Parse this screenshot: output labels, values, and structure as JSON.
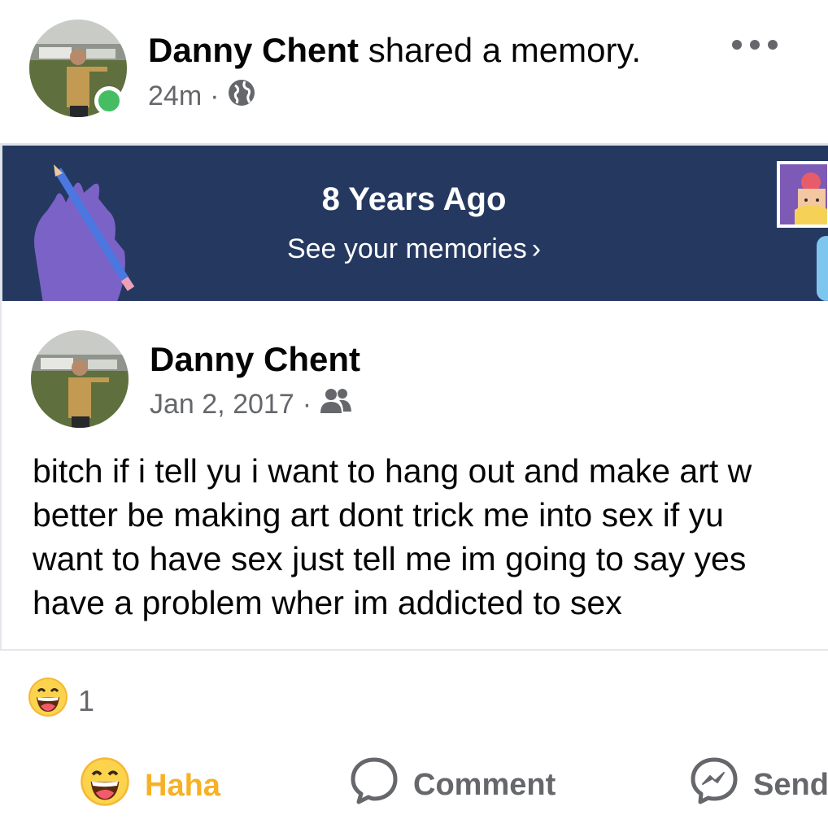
{
  "header": {
    "author_name": "Danny Chent",
    "action_text": "shared a memory.",
    "time": "24m",
    "separator": "·",
    "privacy_icon": "globe-icon",
    "more_icon": "more-horizontal-icon"
  },
  "memory_banner": {
    "title": "8 Years Ago",
    "link": "See your memories",
    "chevron": "›",
    "background_color": "#253860"
  },
  "post": {
    "author": "Danny Chent",
    "date": "Jan 2, 2017",
    "separator": "·",
    "audience_icon": "friends-icon",
    "lines": [
      "bitch if i tell yu i want to hang out and make art w",
      "better be making art dont trick me into sex if yu",
      "want to have sex just tell me im going to say yes",
      "have a problem wher im addicted to sex"
    ]
  },
  "reactions": {
    "icon": "haha-emoji-icon",
    "count": "1"
  },
  "actions": {
    "haha": "Haha",
    "comment": "Comment",
    "send": "Send"
  }
}
